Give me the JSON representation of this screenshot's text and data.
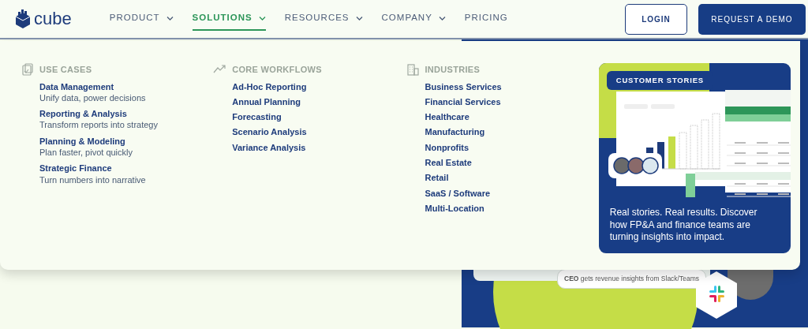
{
  "logo": {
    "text": "cube"
  },
  "nav": [
    {
      "label": "PRODUCT",
      "dropdown": true,
      "selected": false
    },
    {
      "label": "SOLUTIONS",
      "dropdown": true,
      "selected": true
    },
    {
      "label": "RESOURCES",
      "dropdown": true,
      "selected": false
    },
    {
      "label": "COMPANY",
      "dropdown": true,
      "selected": false
    },
    {
      "label": "PRICING",
      "dropdown": false,
      "selected": false
    }
  ],
  "buttons": [
    {
      "label": "LOGIN",
      "kind": "outline"
    },
    {
      "label": "REQUEST A DEMO",
      "kind": "solid"
    }
  ],
  "menu": {
    "columns": [
      {
        "heading": "USE CASES",
        "items": [
          {
            "title": "Data Management",
            "description": "Unify data, power decisions"
          },
          {
            "title": "Reporting & Analysis",
            "description": "Transform reports into strategy"
          },
          {
            "title": "Planning & Modeling",
            "description": "Plan faster, pivot quickly"
          },
          {
            "title": "Strategic Finance",
            "description": "Turn numbers into narrative"
          }
        ]
      },
      {
        "heading": "CORE WORKFLOWS",
        "items": [
          {
            "title": "Ad-Hoc Reporting"
          },
          {
            "title": "Annual Planning"
          },
          {
            "title": "Forecasting"
          },
          {
            "title": "Scenario Analysis"
          },
          {
            "title": "Variance Analysis"
          }
        ]
      },
      {
        "heading": "INDUSTRIES",
        "items": [
          {
            "title": "Business Services"
          },
          {
            "title": "Financial Services"
          },
          {
            "title": "Healthcare"
          },
          {
            "title": "Manufacturing"
          },
          {
            "title": "Nonprofits"
          },
          {
            "title": "Real Estate"
          },
          {
            "title": "Retail"
          },
          {
            "title": "SaaS / Software"
          },
          {
            "title": "Multi-Location"
          }
        ]
      }
    ],
    "promo": {
      "badge": "CUSTOMER STORIES",
      "text": "Real stories. Real results. Discover how FP&A and finance teams are turning insights into impact."
    }
  },
  "hero": {
    "callout": "**CEO** gets revenue insights from Slack/Teams"
  }
}
